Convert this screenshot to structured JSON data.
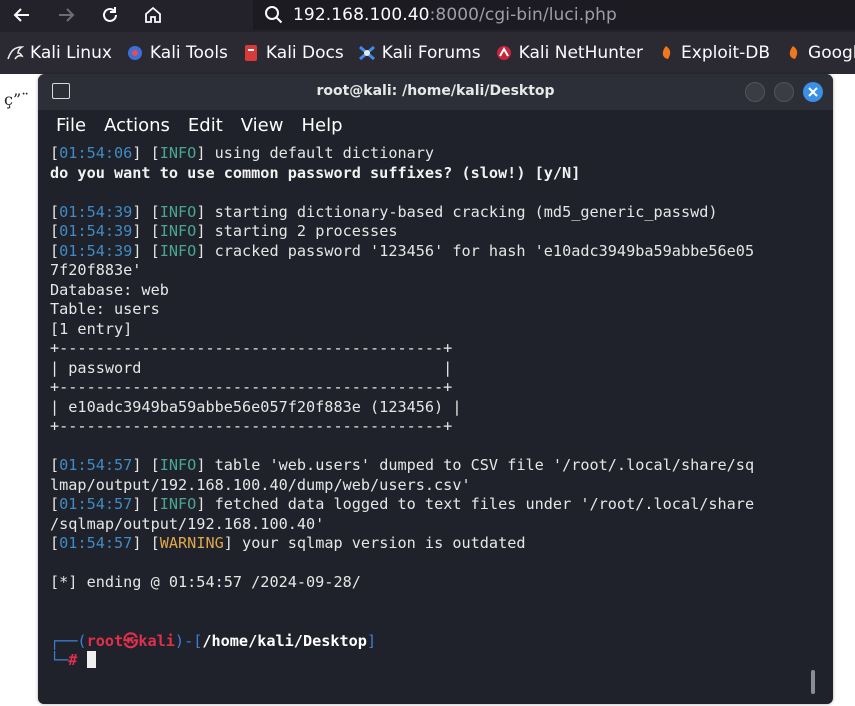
{
  "browser": {
    "url_host": "192.168.100.40",
    "url_rest": ":8000/cgi-bin/luci.php",
    "bookmarks": [
      {
        "label": "Kali Linux",
        "icon": "kali-dragon-icon"
      },
      {
        "label": "Kali Tools",
        "icon": "kali-tools-icon"
      },
      {
        "label": "Kali Docs",
        "icon": "kali-docs-icon"
      },
      {
        "label": "Kali Forums",
        "icon": "kali-forums-icon"
      },
      {
        "label": "Kali NetHunter",
        "icon": "kali-nethunter-icon"
      },
      {
        "label": "Exploit-DB",
        "icon": "exploit-db-icon"
      },
      {
        "label": "Google",
        "icon": "google-icon"
      }
    ]
  },
  "page": {
    "garbled_text": "ç”¨"
  },
  "terminal": {
    "title": "root@kali: /home/kali/Desktop",
    "menu": [
      "File",
      "Actions",
      "Edit",
      "View",
      "Help"
    ],
    "lines": [
      [
        {
          "t": "["
        },
        {
          "t": "01:54:06",
          "c": "b"
        },
        {
          "t": "] ["
        },
        {
          "t": "INFO",
          "c": "g"
        },
        {
          "t": "] using default dictionary"
        }
      ],
      [
        {
          "t": "do you want to use common password suffixes? (slow!) [y/N]",
          "c": "bold"
        }
      ],
      [
        {
          "t": ""
        }
      ],
      [
        {
          "t": "["
        },
        {
          "t": "01:54:39",
          "c": "b"
        },
        {
          "t": "] ["
        },
        {
          "t": "INFO",
          "c": "g"
        },
        {
          "t": "] starting dictionary-based cracking (md5_generic_passwd)"
        }
      ],
      [
        {
          "t": "["
        },
        {
          "t": "01:54:39",
          "c": "b"
        },
        {
          "t": "] ["
        },
        {
          "t": "INFO",
          "c": "g"
        },
        {
          "t": "] starting 2 processes"
        }
      ],
      [
        {
          "t": "["
        },
        {
          "t": "01:54:39",
          "c": "b"
        },
        {
          "t": "] ["
        },
        {
          "t": "INFO",
          "c": "g"
        },
        {
          "t": "] cracked password '123456' for hash 'e10adc3949ba59abbe56e05"
        }
      ],
      [
        {
          "t": "7f20f883e'"
        }
      ],
      [
        {
          "t": "Database: web"
        }
      ],
      [
        {
          "t": "Table: users"
        }
      ],
      [
        {
          "t": "[1 entry]"
        }
      ],
      [
        {
          "t": "+------------------------------------------+"
        }
      ],
      [
        {
          "t": "| password                                 |"
        }
      ],
      [
        {
          "t": "+------------------------------------------+"
        }
      ],
      [
        {
          "t": "| e10adc3949ba59abbe56e057f20f883e (123456) |"
        }
      ],
      [
        {
          "t": "+------------------------------------------+"
        }
      ],
      [
        {
          "t": ""
        }
      ],
      [
        {
          "t": "["
        },
        {
          "t": "01:54:57",
          "c": "b"
        },
        {
          "t": "] ["
        },
        {
          "t": "INFO",
          "c": "g"
        },
        {
          "t": "] table 'web.users' dumped to CSV file '/root/.local/share/sq"
        }
      ],
      [
        {
          "t": "lmap/output/192.168.100.40/dump/web/users.csv'"
        }
      ],
      [
        {
          "t": "["
        },
        {
          "t": "01:54:57",
          "c": "b"
        },
        {
          "t": "] ["
        },
        {
          "t": "INFO",
          "c": "g"
        },
        {
          "t": "] fetched data logged to text files under '/root/.local/share"
        }
      ],
      [
        {
          "t": "/sqlmap/output/192.168.100.40'"
        }
      ],
      [
        {
          "t": "["
        },
        {
          "t": "01:54:57",
          "c": "b"
        },
        {
          "t": "] ["
        },
        {
          "t": "WARNING",
          "c": "w"
        },
        {
          "t": "] your sqlmap version is outdated"
        }
      ],
      [
        {
          "t": ""
        }
      ],
      [
        {
          "t": "[*] ending @ 01:54:57 /2024-09-28/"
        }
      ],
      [
        {
          "t": ""
        }
      ],
      [
        {
          "t": ""
        }
      ],
      [
        {
          "t": "┌──(",
          "c": "pr"
        },
        {
          "t": "root㉿kali",
          "c": "r"
        },
        {
          "t": ")-[",
          "c": "pr"
        },
        {
          "t": "/home/kali/Desktop",
          "c": "path"
        },
        {
          "t": "]",
          "c": "pr"
        }
      ],
      [
        {
          "t": "└─",
          "c": "pr"
        },
        {
          "t": "#",
          "c": "r"
        },
        {
          "t": " "
        },
        {
          "cursor": true
        }
      ]
    ]
  }
}
